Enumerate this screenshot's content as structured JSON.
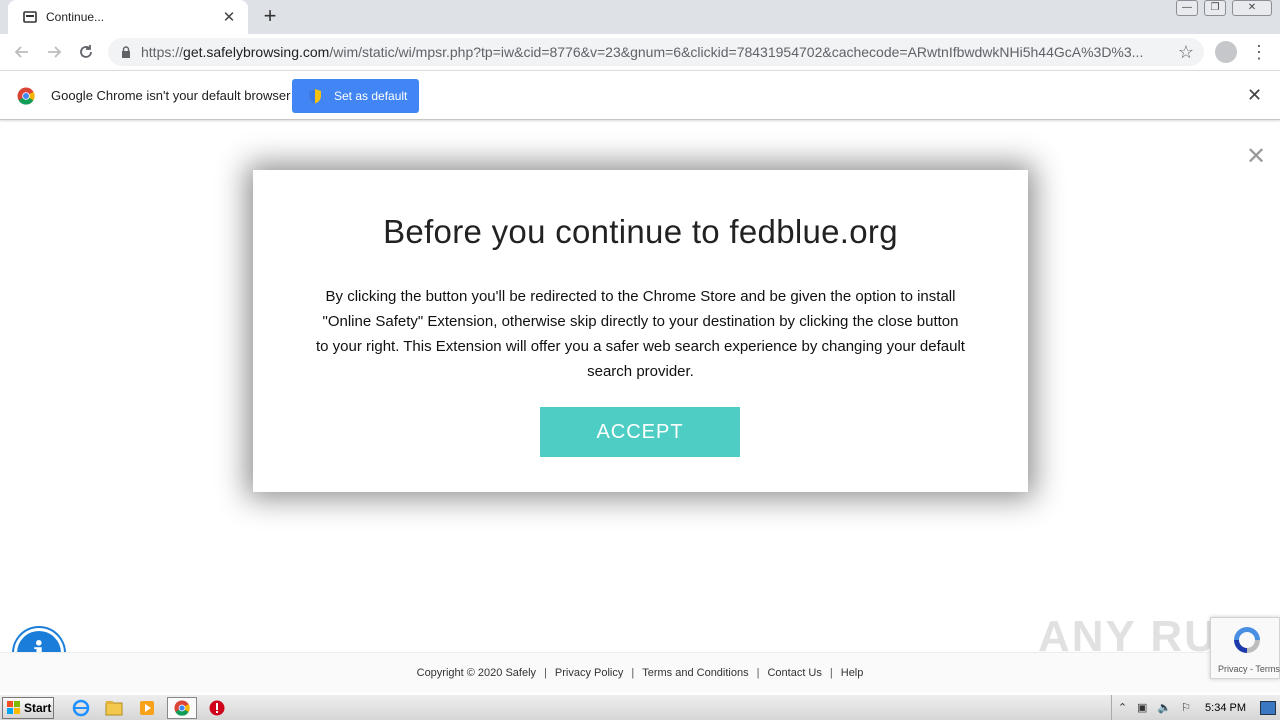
{
  "browser": {
    "tab": {
      "title": "Continue..."
    },
    "new_tab": "+",
    "window_controls": {
      "minimize": "—",
      "restore": "❐",
      "close": "✕"
    },
    "address": {
      "scheme": "https://",
      "host": "get.safelybrowsing.com",
      "path": "/wim/static/wi/mpsr.php?tp=iw&cid=8776&v=23&gnum=6&clickid=78431954702&cachecode=ARwtnIfbwdwkNHi5h44GcA%3D%3..."
    },
    "infobar": {
      "message": "Google Chrome isn't your default browser",
      "button_label": "Set as default",
      "close": "✕"
    }
  },
  "page": {
    "close": "✕",
    "modal": {
      "title": "Before you continue to fedblue.org",
      "body": "By clicking the button you'll be redirected to the Chrome Store and be given the option to install \"Online Safety\" Extension, otherwise skip directly to your destination by clicking the close button to your right. This Extension will offer you a safer web search experience by changing your default search provider.",
      "accept_label": "ACCEPT"
    },
    "info_button": "i",
    "footer": {
      "copyright": "Copyright © 2020 Safely",
      "links": [
        "Privacy Policy",
        "Terms and Conditions",
        "Contact Us",
        "Help"
      ]
    },
    "watermark": "ANY RUN",
    "recaptcha_links": "Privacy - Terms"
  },
  "taskbar": {
    "start_label": "Start",
    "clock": "5:34 PM",
    "colors": {
      "accent": "#4ecdc4",
      "chrome_blue": "#4285f4"
    }
  }
}
